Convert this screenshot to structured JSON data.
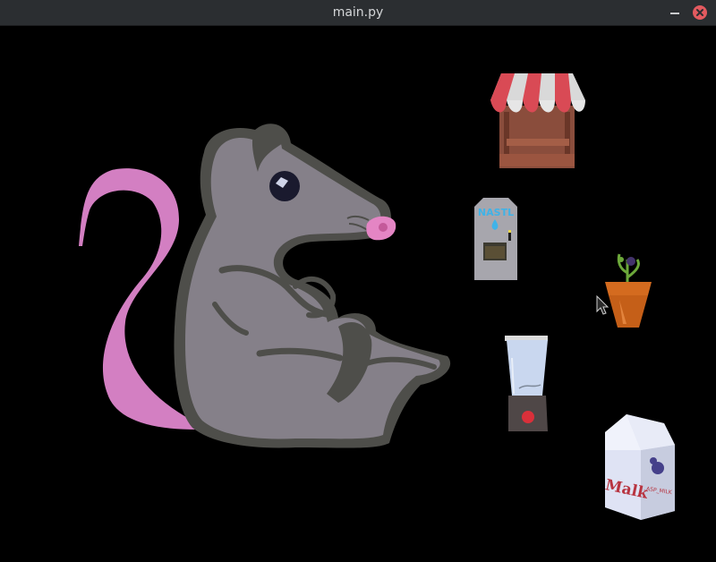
{
  "window": {
    "title": "main.py",
    "minimize_icon": "minimize-icon",
    "close_icon": "close-icon"
  },
  "scene": {
    "background_color": "#000000",
    "sprites": {
      "rat": {
        "icon": "rat-sprite"
      },
      "shop_stall": {
        "icon": "shop-stall-icon"
      },
      "water_dispenser": {
        "icon": "water-dispenser-icon",
        "label": "NASTL"
      },
      "plant_pot": {
        "icon": "potted-plant-icon"
      },
      "blender": {
        "icon": "blender-icon"
      },
      "milk_carton": {
        "icon": "milk-carton-icon",
        "label": "Malk",
        "sublabel": "ASP_MILK"
      }
    },
    "cursor": {
      "icon": "mouse-cursor-icon"
    }
  }
}
